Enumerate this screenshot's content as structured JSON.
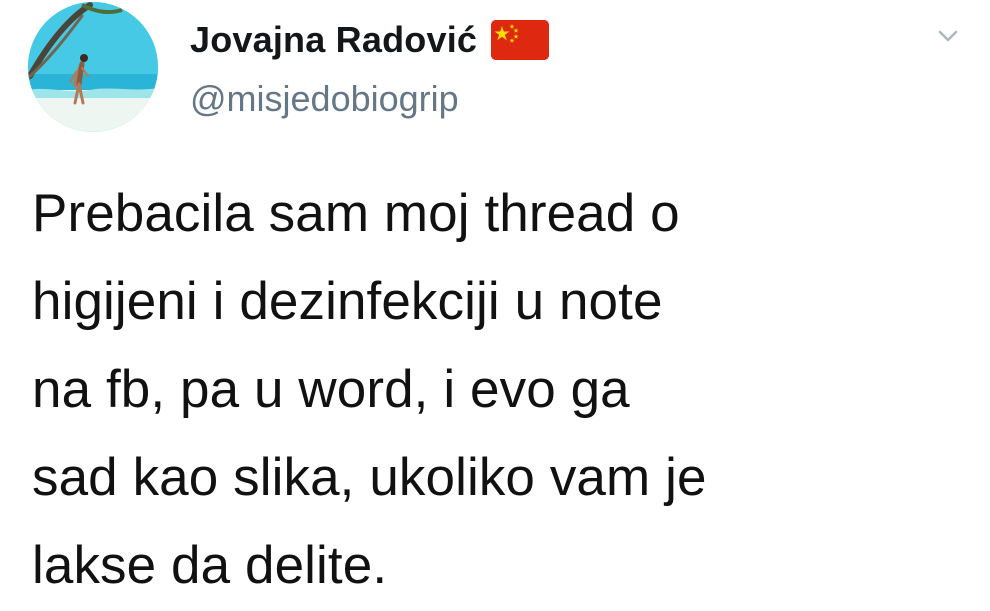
{
  "tweet": {
    "display_name": "Jovajna Radović",
    "flag_icon": "china-flag-icon",
    "handle": "@misjedobiogrip",
    "menu_icon": "chevron-down-icon",
    "text": "Prebacila sam moj thread o\nhigijeni i dezinfekciji u note\nna fb, pa u word, i evo ga\nsad kao slika, ukoliko vam je\nlakse da delite."
  },
  "colors": {
    "text_primary": "#14171a",
    "handle": "#657786",
    "flag_red": "#de2910",
    "flag_yellow": "#ffde00",
    "background": "#ffffff"
  }
}
